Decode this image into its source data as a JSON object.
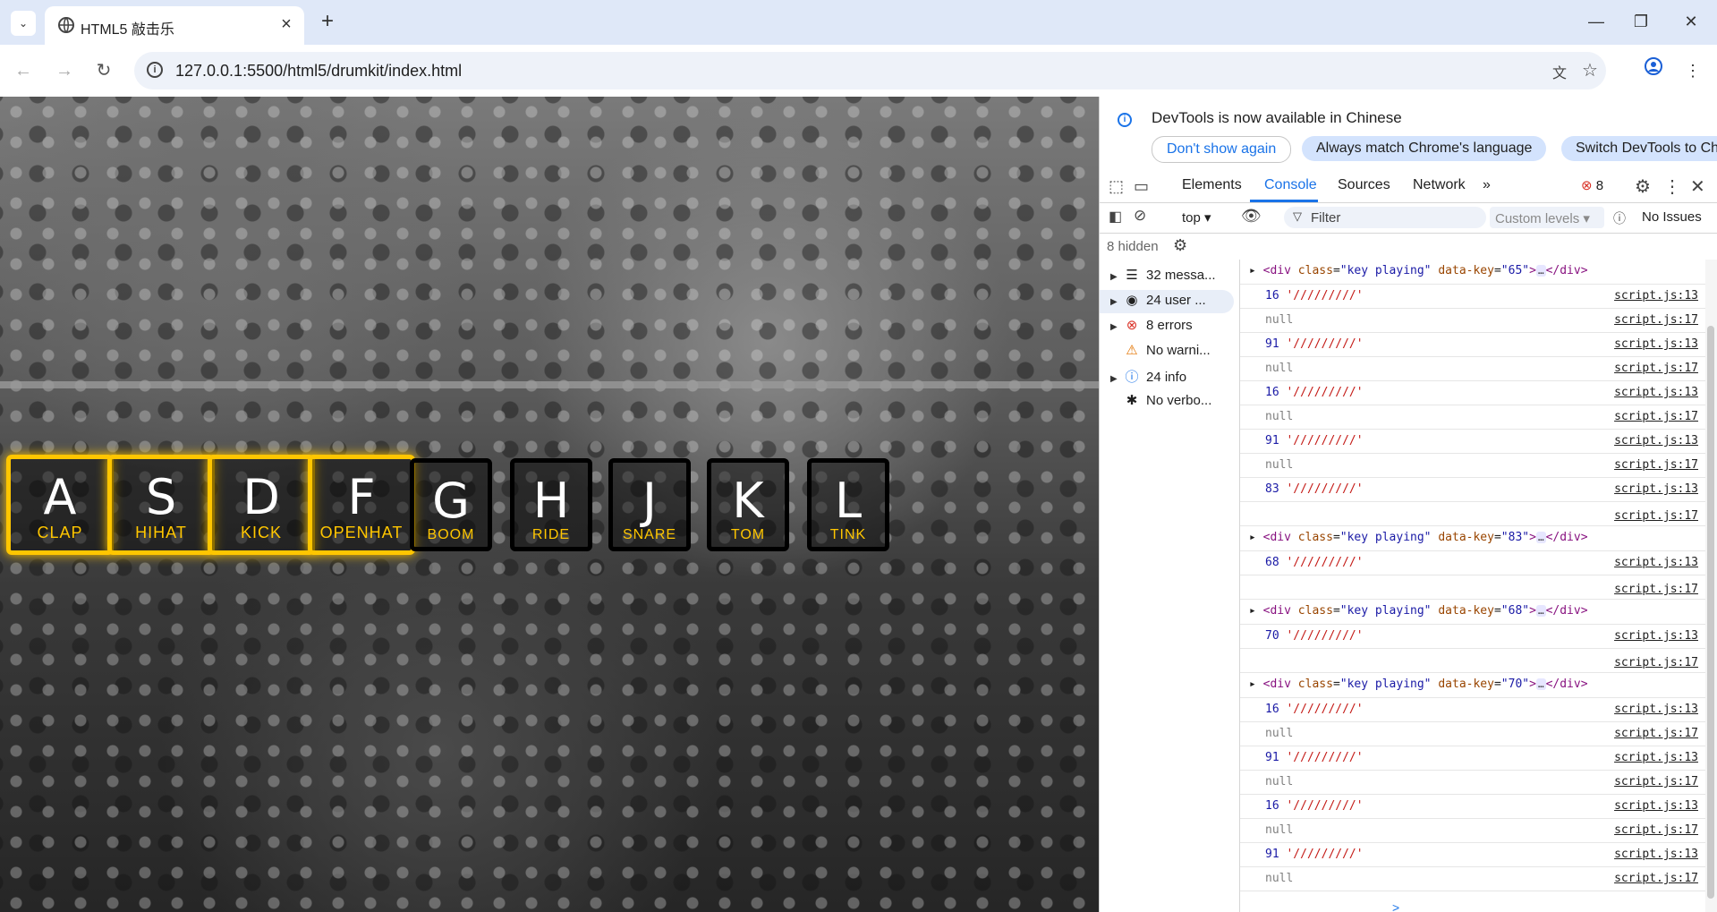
{
  "browser": {
    "tab_title": "HTML5 敲击乐",
    "tab_close": "×",
    "new_tab": "+",
    "tab_search": "⌄",
    "url": "127.0.0.1:5500/html5/drumkit/index.html",
    "window_controls": {
      "minimize": "—",
      "maximize": "❐",
      "close": "✕"
    },
    "nav": {
      "back": "←",
      "forward": "→",
      "reload": "↻"
    }
  },
  "page": {
    "keys": [
      {
        "key": "A",
        "sound": "CLAP",
        "playing": true
      },
      {
        "key": "S",
        "sound": "HIHAT",
        "playing": true
      },
      {
        "key": "D",
        "sound": "KICK",
        "playing": true
      },
      {
        "key": "F",
        "sound": "OPENHAT",
        "playing": true
      },
      {
        "key": "G",
        "sound": "BOOM",
        "playing": false
      },
      {
        "key": "H",
        "sound": "RIDE",
        "playing": false
      },
      {
        "key": "J",
        "sound": "SNARE",
        "playing": false
      },
      {
        "key": "K",
        "sound": "TOM",
        "playing": false
      },
      {
        "key": "L",
        "sound": "TINK",
        "playing": false
      }
    ]
  },
  "devtools": {
    "banner": {
      "text": "DevTools is now available in Chinese",
      "dont_show": "Don't show again",
      "always_match": "Always match Chrome's language",
      "switch": "Switch DevTools to Chin"
    },
    "tabs": {
      "elements": "Elements",
      "console": "Console",
      "sources": "Sources",
      "network": "Network",
      "more": "»"
    },
    "error_count": "8",
    "toolbar": {
      "context": "top ▾",
      "filter_placeholder": "Filter",
      "levels": "Custom levels ▾",
      "issues": "No Issues"
    },
    "hidden": "8 hidden",
    "sidebar": [
      {
        "label": "32 messa...",
        "icon": "list-icon",
        "glyph": "☰",
        "expandable": true
      },
      {
        "label": "24 user ...",
        "icon": "user-icon",
        "glyph": "◉",
        "expandable": true
      },
      {
        "label": "8 errors",
        "icon": "error-icon",
        "glyph": "⊗",
        "expandable": true
      },
      {
        "label": "No warni...",
        "icon": "warning-icon",
        "glyph": "⚠",
        "expandable": false
      },
      {
        "label": "24 info",
        "icon": "info-icon",
        "glyph": "ⓘ",
        "expandable": true
      },
      {
        "label": "No verbo...",
        "icon": "bug-icon",
        "glyph": "✱",
        "expandable": false
      }
    ],
    "log": [
      {
        "type": "el",
        "key": "65"
      },
      {
        "type": "num",
        "num": "16",
        "str": "'/////////'",
        "src": "script.js:13"
      },
      {
        "type": "null",
        "src": "script.js:17"
      },
      {
        "type": "num",
        "num": "91",
        "str": "'/////////'",
        "src": "script.js:13"
      },
      {
        "type": "null",
        "src": "script.js:17"
      },
      {
        "type": "num",
        "num": "16",
        "str": "'/////////'",
        "src": "script.js:13"
      },
      {
        "type": "null",
        "src": "script.js:17"
      },
      {
        "type": "num",
        "num": "91",
        "str": "'/////////'",
        "src": "script.js:13"
      },
      {
        "type": "null",
        "src": "script.js:17"
      },
      {
        "type": "num",
        "num": "83",
        "str": "'/////////'",
        "src": "script.js:13"
      },
      {
        "type": "src",
        "src": "script.js:17"
      },
      {
        "type": "el",
        "key": "83"
      },
      {
        "type": "num",
        "num": "68",
        "str": "'/////////'",
        "src": "script.js:13"
      },
      {
        "type": "src",
        "src": "script.js:17"
      },
      {
        "type": "el",
        "key": "68"
      },
      {
        "type": "num",
        "num": "70",
        "str": "'/////////'",
        "src": "script.js:13"
      },
      {
        "type": "src",
        "src": "script.js:17"
      },
      {
        "type": "el",
        "key": "70"
      },
      {
        "type": "num",
        "num": "16",
        "str": "'/////////'",
        "src": "script.js:13"
      },
      {
        "type": "null",
        "src": "script.js:17"
      },
      {
        "type": "num",
        "num": "91",
        "str": "'/////////'",
        "src": "script.js:13"
      },
      {
        "type": "null",
        "src": "script.js:17"
      },
      {
        "type": "num",
        "num": "16",
        "str": "'/////////'",
        "src": "script.js:13"
      },
      {
        "type": "null",
        "src": "script.js:17"
      },
      {
        "type": "num",
        "num": "91",
        "str": "'/////////'",
        "src": "script.js:13"
      },
      {
        "type": "null",
        "src": "script.js:17"
      }
    ],
    "null_text": "null",
    "element_html": {
      "open": "<div",
      "cls_attr": "class",
      "cls_val": "\"key playing\"",
      "key_attr": "data-key",
      "ellipsis": "…",
      "close": "</div>"
    },
    "prompt": ">"
  }
}
